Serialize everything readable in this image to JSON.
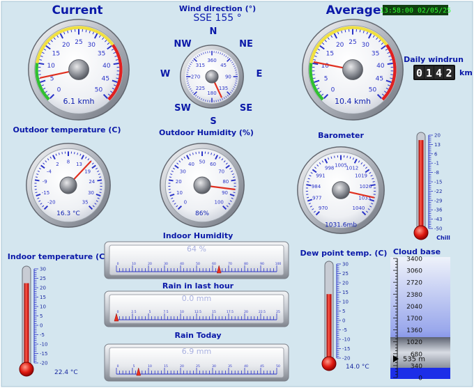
{
  "colors": {
    "background": "#d4e6ef",
    "label_blue": "#0a18a8",
    "needle_red": "#e03020",
    "clock_bg": "#104010",
    "clock_fg": "#30ff30"
  },
  "header": {
    "current_title": "Current",
    "average_title": "Average",
    "timestamp": "13:58:00 02/05/25"
  },
  "wind_direction": {
    "title": "Wind direction (°)",
    "value_text": "SSE  155 °",
    "bearing_deg": 155,
    "compass": {
      "n": "N",
      "ne": "NE",
      "e": "E",
      "se": "SE",
      "s": "S",
      "sw": "SW",
      "w": "W",
      "nw": "NW"
    },
    "ticks": [
      "360",
      "45",
      "90",
      "135",
      "180",
      "225",
      "270",
      "315"
    ]
  },
  "windrun": {
    "title": "Daily windrun",
    "digits": [
      "0",
      "1",
      "4",
      "2"
    ],
    "unit": "km"
  },
  "wind_current": {
    "readout": "6.1 kmh",
    "value": 6.1,
    "min": 0,
    "max": 50,
    "ticks": [
      "0",
      "5",
      "10",
      "15",
      "20",
      "25",
      "30",
      "35",
      "40",
      "45",
      "50"
    ]
  },
  "wind_average": {
    "readout": "10.4 kmh",
    "value": 10.4,
    "min": 0,
    "max": 50,
    "ticks": [
      "0",
      "5",
      "10",
      "15",
      "20",
      "25",
      "30",
      "35",
      "40",
      "45",
      "50"
    ]
  },
  "outdoor_temp": {
    "title": "Outdoor temperature (C)",
    "readout": "16.3 °C",
    "value": 16.3,
    "min": -20,
    "max": 35,
    "ticks": [
      "-20",
      "-15",
      "-9",
      "-4",
      "2",
      "8",
      "13",
      "19",
      "24",
      "30",
      "35"
    ]
  },
  "outdoor_humidity": {
    "title": "Outdoor Humidity (%)",
    "readout": "86%",
    "value": 86,
    "min": 0,
    "max": 100,
    "ticks": [
      "0",
      "10",
      "20",
      "30",
      "40",
      "50",
      "60",
      "70",
      "80",
      "90",
      "100"
    ]
  },
  "barometer": {
    "title": "Barometer",
    "readout": "1031.6mb",
    "value": 1031.6,
    "min": 970,
    "max": 1040,
    "ticks": [
      "970",
      "977",
      "984",
      "991",
      "998",
      "1005",
      "1012",
      "1019",
      "1026",
      "1033",
      "1040"
    ]
  },
  "chill": {
    "label": "Chill",
    "ticks": [
      "20",
      "13",
      "6",
      "-1",
      "-8",
      "-15",
      "-22",
      "-29",
      "-36",
      "-43",
      "-50"
    ],
    "value": 16.3,
    "min": -50,
    "max": 20
  },
  "indoor_temp": {
    "title": "Indoor temperature (C)",
    "readout": "22.4 °C",
    "value": 22.4,
    "min": -20,
    "max": 30,
    "ticks": [
      "30",
      "25",
      "20",
      "15",
      "10",
      "5",
      "0",
      "-5",
      "-10",
      "-15",
      "-20"
    ]
  },
  "dew_point": {
    "title": "Dew point temp. (C)",
    "readout": "14.0 °C",
    "value": 14.0,
    "min": -20,
    "max": 30,
    "ticks": [
      "30",
      "25",
      "20",
      "15",
      "10",
      "5",
      "0",
      "-5",
      "-10",
      "-15",
      "-20"
    ]
  },
  "indoor_humidity": {
    "title": "Indoor Humidity",
    "readout": "64 %",
    "value": 64,
    "min": 0,
    "max": 100,
    "ticks": [
      "0",
      "10",
      "20",
      "30",
      "40",
      "50",
      "60",
      "70",
      "80",
      "90",
      "100"
    ]
  },
  "rain_last_hour": {
    "title": "Rain in last hour",
    "readout": "0.0 mm",
    "value": 0.0,
    "min": 0,
    "max": 25,
    "ticks": [
      "0",
      "2.5",
      "5",
      "7.5",
      "10",
      "12.5",
      "15",
      "17.5",
      "20",
      "22.5",
      "25"
    ]
  },
  "rain_today": {
    "title": "Rain Today",
    "readout": "6.9 mm",
    "value": 6.9,
    "min": 0,
    "max": 50,
    "ticks": [
      "0",
      "5",
      "10",
      "15",
      "20",
      "25",
      "30",
      "35",
      "40",
      "45",
      "50"
    ]
  },
  "cloud_base": {
    "title": "Cloud base",
    "readout": "535 m",
    "value": 535,
    "ticks": [
      "3400",
      "3060",
      "2720",
      "2380",
      "2040",
      "1700",
      "1360",
      "1020",
      "680",
      "340",
      "0"
    ]
  }
}
